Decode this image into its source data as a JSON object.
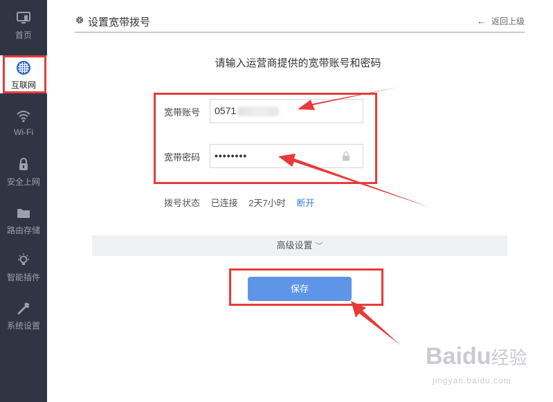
{
  "sidebar": {
    "items": [
      {
        "label": "首页",
        "icon": "monitor-icon"
      },
      {
        "label": "互联网",
        "icon": "globe-icon"
      },
      {
        "label": "Wi-Fi",
        "icon": "wifi-icon"
      },
      {
        "label": "安全上网",
        "icon": "lock-icon"
      },
      {
        "label": "路由存储",
        "icon": "folder-icon"
      },
      {
        "label": "智能插件",
        "icon": "lightbulb-icon"
      },
      {
        "label": "系统设置",
        "icon": "wrench-icon"
      }
    ],
    "active_index": 1
  },
  "header": {
    "title": "设置宽带拨号",
    "back_label": "返回上级"
  },
  "main": {
    "instruction": "请输入运营商提供的宽带账号和密码",
    "account_label": "宽带账号",
    "account_value": "0571",
    "password_label": "宽带密码",
    "password_value": "••••••••",
    "status_label": "拨号状态",
    "status_value": "已连接",
    "uptime": "2天7小时",
    "disconnect_label": "断开",
    "advanced_label": "高级设置",
    "save_label": "保存"
  },
  "watermark": {
    "brand": "Bai",
    "brand_suffix": "du",
    "cn": "经验",
    "url": "jingyan.baidu.com"
  },
  "colors": {
    "sidebar_bg": "#2f3542",
    "accent": "#5e95e6",
    "link": "#3b7fdc",
    "annotation_red": "#e83a3a"
  }
}
